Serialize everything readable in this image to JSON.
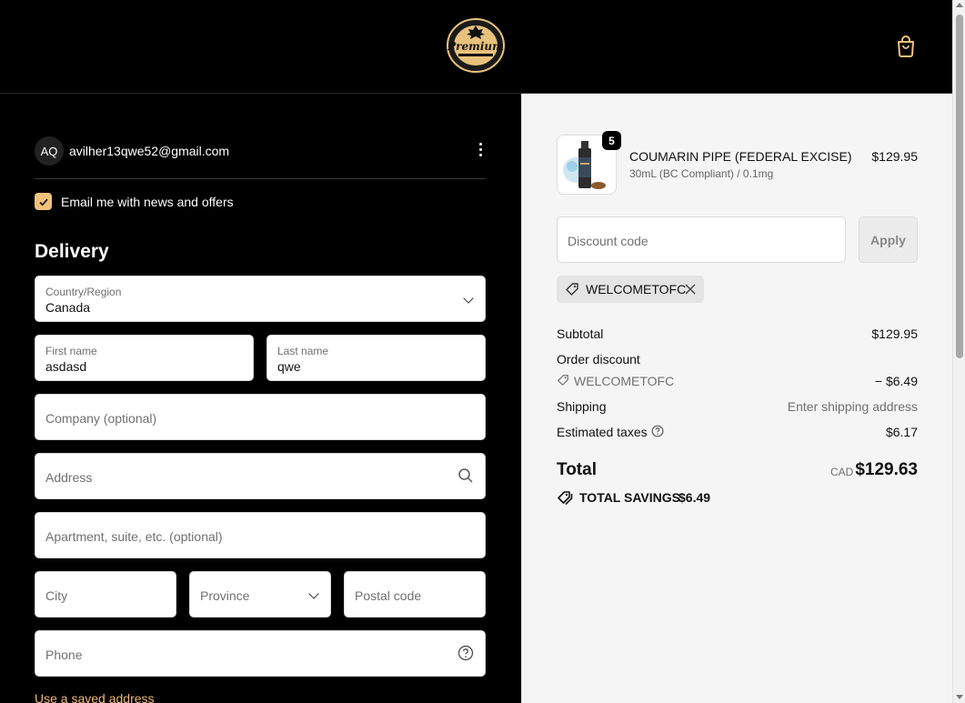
{
  "header": {
    "logo_text": "Premium",
    "cart_icon": "shopping-bag-icon"
  },
  "account": {
    "initials": "AQ",
    "email": "avilher13qwe52@gmail.com"
  },
  "newsletter": {
    "label": "Email me with news and offers",
    "checked": true
  },
  "delivery": {
    "title": "Delivery",
    "country_label": "Country/Region",
    "country_value": "Canada",
    "first_name_label": "First name",
    "first_name_value": "asdasd",
    "last_name_label": "Last name",
    "last_name_value": "qwe",
    "company_placeholder": "Company (optional)",
    "address_placeholder": "Address",
    "apartment_placeholder": "Apartment, suite, etc. (optional)",
    "city_placeholder": "City",
    "province_placeholder": "Province",
    "postal_placeholder": "Postal code",
    "phone_placeholder": "Phone",
    "saved_address_link": "Use a saved address"
  },
  "summary": {
    "product": {
      "quantity": "5",
      "name": "COUMARIN PIPE (FEDERAL EXCISE)",
      "variant": "30mL (BC Compliant) / 0.1mg",
      "price": "$129.95"
    },
    "discount_placeholder": "Discount code",
    "apply_label": "Apply",
    "applied_code": "WELCOMETOFC",
    "subtotal_label": "Subtotal",
    "subtotal_value": "$129.95",
    "order_discount_label": "Order discount",
    "discount_code": "WELCOMETOFC",
    "discount_value": "− $6.49",
    "shipping_label": "Shipping",
    "shipping_value": "Enter shipping address",
    "taxes_label": "Estimated taxes",
    "taxes_value": "$6.17",
    "total_label": "Total",
    "total_currency": "CAD",
    "total_value": "$129.63",
    "savings_label": "TOTAL SAVINGS",
    "savings_value": "$6.49"
  },
  "colors": {
    "accent": "#f0c27a",
    "link": "#f0b87a",
    "panel_bg": "#f5f5f5"
  }
}
